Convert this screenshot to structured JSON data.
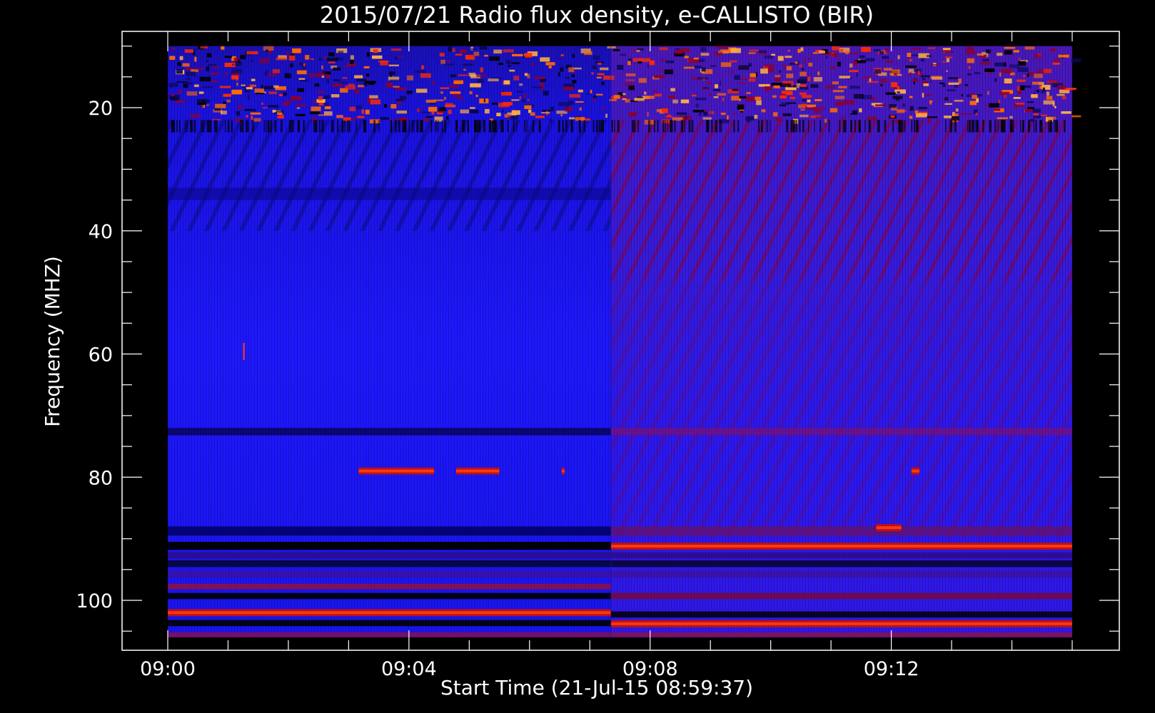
{
  "chart_data": {
    "type": "heatmap",
    "title": "2015/07/21  Radio flux density, e-CALLISTO (BIR)",
    "xlabel": "Start Time (21-Jul-15 08:59:37)",
    "ylabel": "Frequency (MHZ)",
    "x_ticks": [
      "09:00",
      "09:04",
      "09:08",
      "09:12"
    ],
    "y_ticks": [
      20,
      40,
      60,
      80,
      100
    ],
    "xlim": [
      "08:59:37",
      "09:15:30"
    ],
    "ylim": [
      10,
      108
    ],
    "y_inverted": true,
    "data_x_range": [
      "09:00:00",
      "09:15:00"
    ],
    "data_y_range": [
      10,
      106
    ],
    "colormap": [
      "#000000",
      "#1a14ff",
      "#9a0034",
      "#ff2a00",
      "#ffd060"
    ],
    "regime_change_time": "09:07:21",
    "bright_bands": [
      {
        "start": "09:03:10",
        "end": "09:04:25",
        "freq": 79
      },
      {
        "start": "09:04:47",
        "end": "09:05:30",
        "freq": 79
      },
      {
        "start": "09:06:32",
        "end": "09:06:35",
        "freq": 79
      },
      {
        "start": "09:12:20",
        "end": "09:12:28",
        "freq": 79
      },
      {
        "start": "09:07:21",
        "end": "09:15:00",
        "freq": 91.2
      },
      {
        "start": "09:00:00",
        "end": "09:07:21",
        "freq": 102
      },
      {
        "start": "09:07:21",
        "end": "09:15:00",
        "freq": 103.8
      },
      {
        "start": "09:11:45",
        "end": "09:12:10",
        "freq": 88.2
      }
    ]
  }
}
